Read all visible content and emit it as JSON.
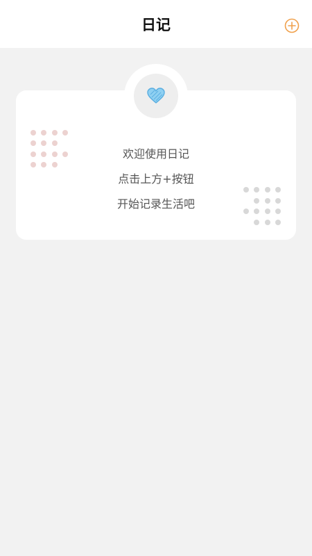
{
  "header": {
    "title": "日记",
    "add_icon": "plus-circle-icon",
    "accent_color": "#f0a04b"
  },
  "empty_state": {
    "icon": "heart-icon",
    "icon_color": "#6fbfe8",
    "line1": "欢迎使用日记",
    "line2": "点击上方+按钮",
    "line3": "开始记录生活吧"
  }
}
